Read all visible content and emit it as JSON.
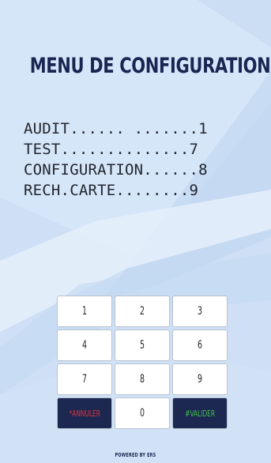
{
  "screen": {
    "title": "MENU DE CONFIGURATION",
    "background_color": "#cfe0f6",
    "title_color": "#1a2552"
  },
  "menu": {
    "items": [
      {
        "text": "AUDIT...... .......1"
      },
      {
        "text": "TEST..............7"
      },
      {
        "text": "CONFIGURATION......8"
      },
      {
        "text": "RECH.CARTE........9"
      }
    ]
  },
  "keypad": {
    "keys": [
      {
        "label": "1"
      },
      {
        "label": "2"
      },
      {
        "label": "3"
      },
      {
        "label": "4"
      },
      {
        "label": "5"
      },
      {
        "label": "6"
      },
      {
        "label": "7"
      },
      {
        "label": "8"
      },
      {
        "label": "9"
      },
      {
        "label": "*ANNULER"
      },
      {
        "label": "0"
      },
      {
        "label": "#VALIDER"
      }
    ],
    "cancel_color": "#e0323a",
    "validate_color": "#3fc04a",
    "dark_key_bg": "#1c2850"
  },
  "footer": {
    "powered_by": "POWERED BY ERS"
  }
}
